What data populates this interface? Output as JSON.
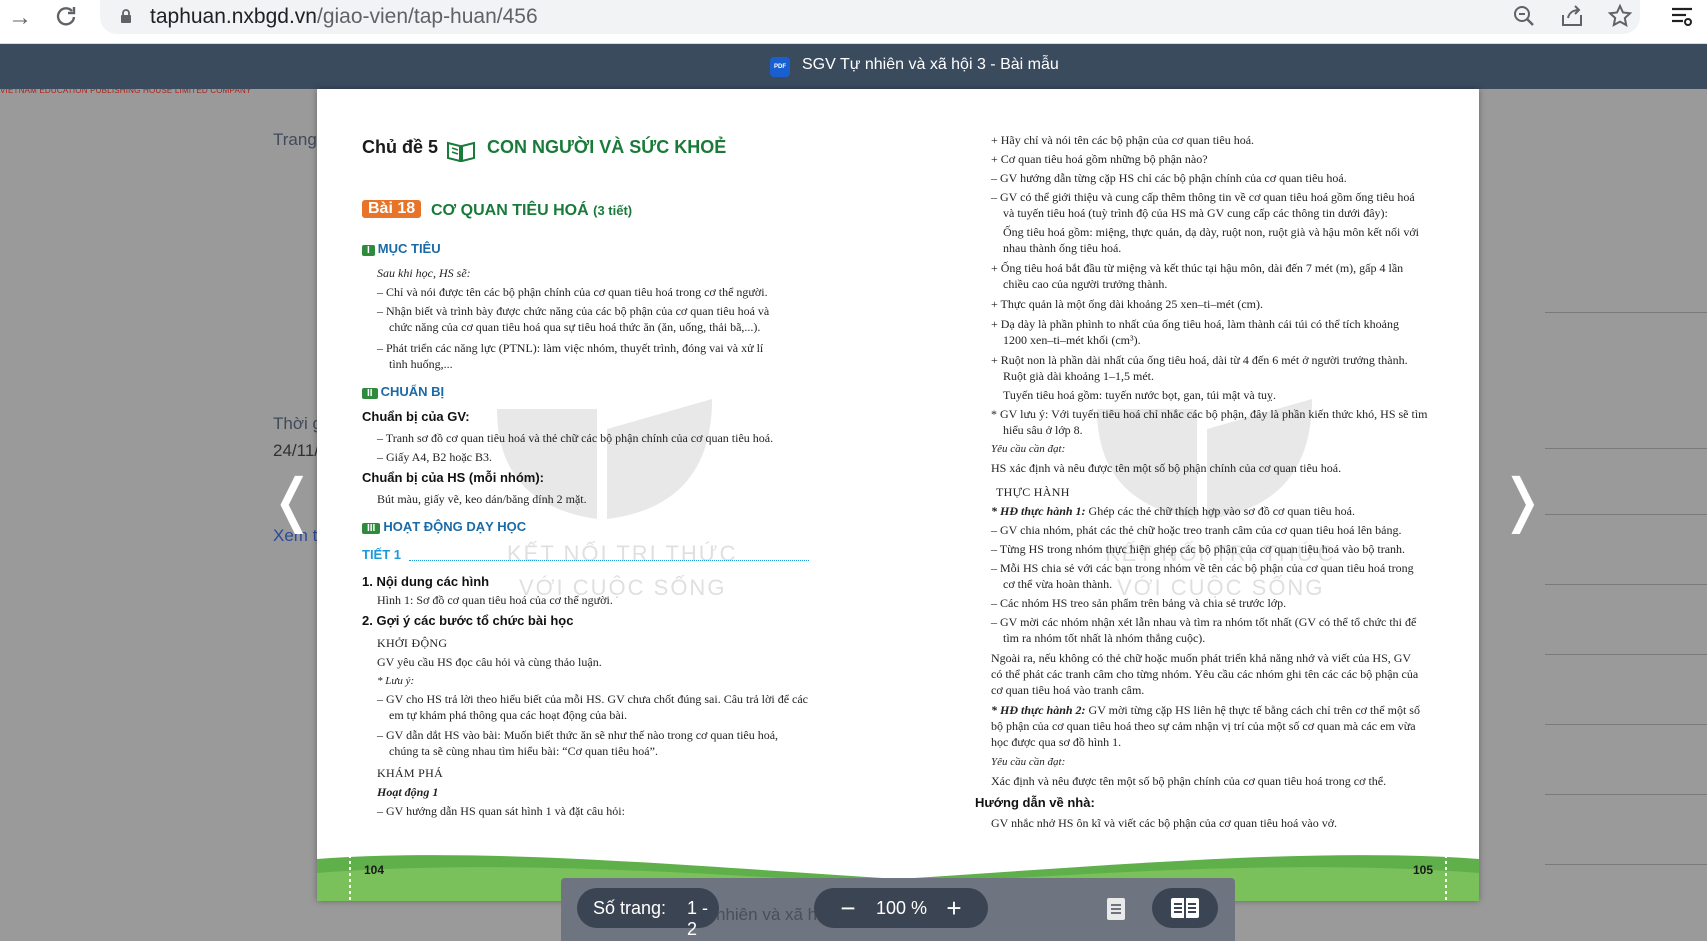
{
  "browser": {
    "url_host": "taphuan.nxbgd.vn",
    "url_path": "/giao-vien/tap-huan/456"
  },
  "background_page": {
    "red_strip": "VIETNAM EDUCATION PUBLISHING HOUSE LIMITED COMPANY",
    "trang": "Trang",
    "thoi": "Thời g",
    "date": "24/11/",
    "xem": "Xem t",
    "under_toolbar": "nhiên và xã hộ"
  },
  "viewer": {
    "pdf_badge": "PDF",
    "title": "SGV Tự nhiên và xã hội 3 - Bài mẫu",
    "pages_label": "Số trang:",
    "pages_value": "1 - 2",
    "zoom_minus": "−",
    "zoom_value": "100 %",
    "zoom_plus": "+",
    "prev": "❬",
    "next": "❭"
  },
  "left_page": {
    "topic_label": "Chủ đề 5",
    "topic_title": "CON NGƯỜI VÀ SỨC KHOẺ",
    "lesson_badge": "Bài 18",
    "lesson_title": "CƠ QUAN TIÊU HOÁ",
    "lesson_sub": "(3 tiết)",
    "sec1_num": "I",
    "sec1_title": "MỤC TIÊU",
    "intro": "Sau khi học, HS sẽ:",
    "goal1": "– Chỉ và nói được tên các bộ phận chính của cơ quan tiêu hoá trong cơ thể người.",
    "goal2a": "– Nhận biết và trình bày được chức năng của các bộ phận của cơ quan tiêu hoá và",
    "goal2b": "chức năng của cơ quan tiêu hoá qua sự tiêu hoá thức ăn (ăn, uống, thải bã,...).",
    "goal3a": "– Phát triển các năng lực (PTNL): làm việc nhóm, thuyết trình, đóng vai và xử lí",
    "goal3b": "tình huống,...",
    "sec2_num": "II",
    "sec2_title": "CHUẨN BỊ",
    "gv_head": "Chuẩn bị của GV:",
    "gv1": "– Tranh sơ đồ cơ quan tiêu hoá và thẻ chữ các bộ phận chính của cơ quan tiêu hoá.",
    "gv2": "– Giấy A4, B2 hoặc B3.",
    "hs_head": "Chuẩn bị của HS (mỗi nhóm):",
    "hs1": "Bút màu, giấy vẽ, keo dán/băng dính 2 mặt.",
    "sec3_num": "III",
    "sec3_title": "HOẠT ĐỘNG DẠY HỌC",
    "tiet": "TIẾT 1",
    "h1": "1. Nội dung các hình",
    "h1_text": "Hình 1: Sơ đồ cơ quan tiêu hoá của cơ thể người.",
    "h2": "2. Gợi ý các bước tổ chức bài học",
    "khoidong": "KHỞI ĐỘNG",
    "kd1": "GV yêu cầu HS đọc câu hỏi và cùng thảo luận.",
    "luuy": "* Lưu ý:",
    "ly1a": "– GV cho HS trả lời theo hiểu biết của mỗi HS. GV chưa chốt đúng sai. Câu trả lời để các",
    "ly1b": "em tự khám phá thông qua các hoạt động của bài.",
    "ly2a": "–  GV dẫn dắt HS vào bài: Muốn biết thức ăn sẽ như thế nào trong cơ quan tiêu hoá,",
    "ly2b": "chúng ta sẽ cùng nhau tìm hiểu bài: “Cơ quan tiêu hoá”.",
    "khampha": "KHÁM PHÁ",
    "hd1": "Hoạt động 1",
    "hd1_text": "– GV hướng dẫn HS quan sát hình 1 và đặt câu hỏi:",
    "page_no": "104",
    "wm1": "KẾT NỐI TRI THỨC",
    "wm2": "VỚI CUỘC SỐNG"
  },
  "right_page": {
    "l1": "+  Hãy chỉ và nói tên các bộ phận của cơ quan tiêu hoá.",
    "l2": "+  Cơ quan tiêu hoá gồm những bộ phận nào?",
    "l3": "–  GV hướng dẫn từng cặp HS chỉ các bộ phận chính của cơ quan tiêu hoá.",
    "l4a": "–  GV có thể giới thiệu và cung cấp thêm thông tin về cơ quan tiêu hoá gồm ống tiêu hoá",
    "l4b": "và tuyến tiêu hoá (tuỳ trình độ của HS mà GV cung cấp các thông tin dưới đây):",
    "l5a": "Ống tiêu hoá gồm: miệng, thực quản, dạ dày, ruột non, ruột già và hậu môn kết nối với",
    "l5b": "nhau thành ống tiêu hoá.",
    "l6a": "+  Ống tiêu hoá bắt đầu từ miệng và kết thúc tại hậu môn, dài đến 7 mét (m), gấp 4 lần",
    "l6b": "chiều cao của người trưởng thành.",
    "l7": "+  Thực quản là một ống dài khoảng 25 xen–ti–mét (cm).",
    "l8a": "+  Dạ dày là phần phình to nhất của ống tiêu hoá, làm thành cái túi có thể tích khoảng",
    "l8b": "1200 xen–ti–mét khối (cm³).",
    "l9a": "+  Ruột non là phần dài nhất của ống tiêu hoá, dài từ 4 đến 6 mét ở người trưởng thành.",
    "l9b": "Ruột già dài khoảng 1–1,5 mét.",
    "l10": "Tuyến tiêu hoá gồm: tuyến nước bọt, gan, túi mật và tuỵ.",
    "l11a": "*  GV lưu ý: Với tuyến tiêu hoá chỉ nhắc các bộ phận, đây là phần kiến thức khó, HS sẽ tìm",
    "l11b": "hiểu sâu ở lớp 8.",
    "ycd": "Yêu cầu cần đạt:",
    "ycd_text": "HS xác định và nêu được tên một số bộ phận chính của cơ quan tiêu hoá.",
    "thuchanh": "THỰC HÀNH",
    "hd_th1_label": "* HĐ thực hành 1:",
    "hd_th1": " Ghép các thẻ chữ thích hợp vào sơ đồ cơ quan tiêu hoá.",
    "t1": "–  GV chia nhóm, phát các thẻ chữ hoặc treo tranh câm của cơ quan tiêu hoá lên bảng.",
    "t2": "–  Từng HS trong nhóm thực hiện ghép các bộ phận của cơ quan tiêu hoá vào bộ tranh.",
    "t3a": "–  Mỗi HS chia sẻ với các bạn trong nhóm về tên các bộ phận của cơ quan tiêu hoá trong",
    "t3b": "cơ thể vừa hoàn thành.",
    "t4": "–  Các nhóm HS treo sản phẩm trên bảng và chia sẻ trước lớp.",
    "t5a": "–  GV mời các nhóm nhận xét lẫn nhau và tìm ra nhóm tốt nhất (GV có thể tổ chức thi để",
    "t5b": "tìm ra nhóm tốt nhất là nhóm thắng cuộc).",
    "p1a": "Ngoài ra, nếu không có thẻ chữ hoặc muốn phát triển khả năng nhớ và viết của HS, GV",
    "p1b": "có thể phát các tranh câm cho từng nhóm. Yêu cầu các nhóm ghi tên các các bộ phận của",
    "p1c": "cơ quan tiêu hoá vào tranh câm.",
    "hd_th2_label": "* HĐ thực hành 2:",
    "hd_th2": " GV mời từng cặp HS liên hệ thực tế bằng cách chỉ trên cơ thể một số",
    "th2b": "bộ phận của cơ quan tiêu hoá theo sự cảm nhận vị trí của một số cơ quan mà các em vừa",
    "th2c": "học được qua sơ đồ hình 1.",
    "ycd2": "Yêu cầu cần đạt:",
    "ycd2_text": "Xác định và nêu được tên một số bộ phận chính của cơ quan tiêu hoá trong cơ thể.",
    "hdvn": "Hướng dẫn về nhà:",
    "hdvn_text": "GV nhắc nhở HS ôn kĩ và viết các bộ phận của cơ quan tiêu hoá vào vở.",
    "page_no": "105",
    "wm1": "KẾT NỐI TRI THỨC",
    "wm2": "VỚI CUỘC SỐNG"
  },
  "colors": {
    "header_bg": "#3b4b5e",
    "green": "#1a7a3a",
    "orange": "#e8742a",
    "blue_heading": "#1a6aa8",
    "footer_green": "#5fb04a"
  }
}
